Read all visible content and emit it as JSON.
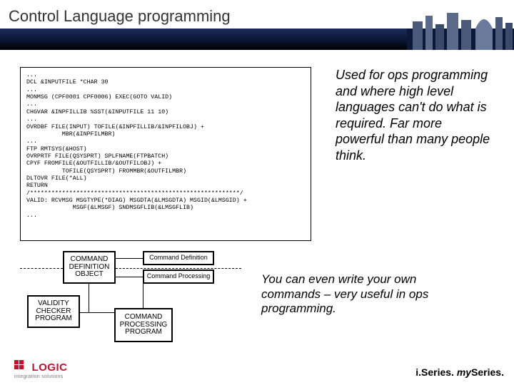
{
  "title": "Control Language programming",
  "code": "...\nDCL &INPUTFILE *CHAR 30\n...\nMONMSG (CPF0001 CPF0006) EXEC(GOTO VALID)\n...\nCHGVAR &INPFILLIB %SST(&INPUTFILE 11 10)\n...\nOVRDBF FILE(INPUT) TOFILE(&INPFILLIB/&INPFILOBJ) +\n          MBR(&INPFILMBR)\n...\nFTP RMTSYS(&HOST)\nOVRPRTF FILE(QSYSPRT) SPLFNAME(FTPBATCH)\nCPYF FROMFILE(&OUTFILLIB/&OUTFILOBJ) +\n          TOFILE(QSYSPRT) FROMMBR(&OUTFILMBR)\nDLTOVR FILE(*ALL)\nRETURN\n/***********************************************************/\nVALID: RCVMSG MSGTYPE(*DIAG) MSGDTA(&LMSGDTA) MSGID(&LMSGID) +\n             MSGF(&LMSGF) SNDMSGFLIB(&LMSGFLIB)\n...",
  "note1": "Used for ops programming and where high level languages can't do what is required. Far more powerful than many people think.",
  "diagram": {
    "cdo": "COMMAND DEFINITION OBJECT",
    "cd": "Command Definition",
    "cp": "Command Processing",
    "vcp": "VALIDITY CHECKER PROGRAM",
    "cpp": "COMMAND PROCESSING PROGRAM"
  },
  "note2": "You can even write your own commands – very useful in ops programming.",
  "footer": {
    "logo_main": "LOGIC",
    "logo_sub": "integration solutions",
    "brand_i": "i.",
    "brand_series1": "Series.",
    "brand_my": "my",
    "brand_series2": "Series."
  }
}
